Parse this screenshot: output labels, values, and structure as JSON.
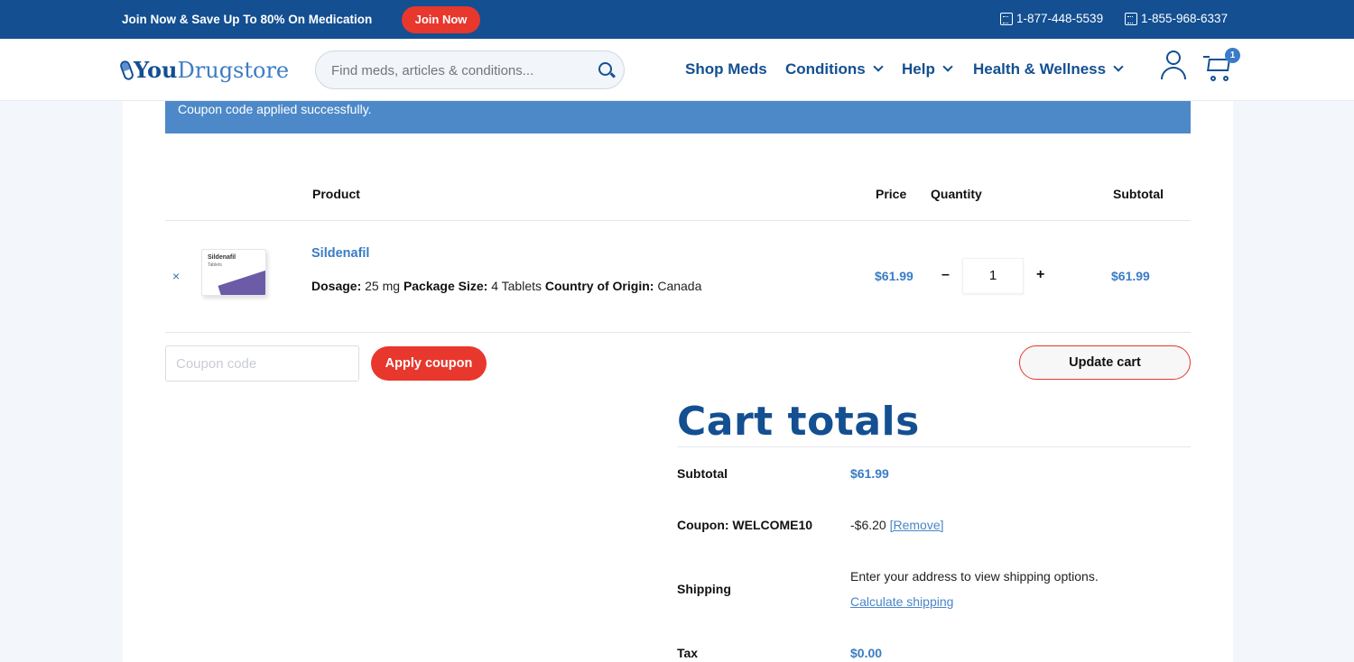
{
  "topbar": {
    "promo_text": "Join Now & Save Up To 80% On Medication",
    "join_label": "Join Now",
    "phone_1": "1-877-448-5539",
    "phone_2": "1-855-968-6337"
  },
  "header": {
    "logo_you": "You",
    "logo_drugstore": "Drugstore",
    "search_placeholder": "Find meds, articles & conditions...",
    "nav": {
      "shop_meds": "Shop Meds",
      "conditions": "Conditions",
      "help": "Help",
      "health_wellness": "Health & Wellness"
    },
    "cart_count": "1"
  },
  "notice": {
    "message": "Coupon code applied successfully."
  },
  "cart_table": {
    "headers": {
      "product": "Product",
      "price": "Price",
      "quantity": "Quantity",
      "subtotal": "Subtotal"
    },
    "items": [
      {
        "remove": "×",
        "image_title": "Sildenafil",
        "image_subtitle": "Tablets",
        "name": "Sildenafil",
        "dosage_label": "Dosage:",
        "dosage_value": "25 mg",
        "package_label": "Package Size:",
        "package_value": "4 Tablets",
        "origin_label": "Country of Origin:",
        "origin_value": "Canada",
        "price": "$61.99",
        "qty_minus": "–",
        "quantity": "1",
        "qty_plus": "+",
        "subtotal": "$61.99"
      }
    ]
  },
  "actions": {
    "coupon_placeholder": "Coupon code",
    "apply_label": "Apply coupon",
    "update_label": "Update cart"
  },
  "totals": {
    "title": "Cart totals",
    "subtotal_label": "Subtotal",
    "subtotal_value": "$61.99",
    "coupon_label": "Coupon: WELCOME10",
    "coupon_value": "-$6.20",
    "coupon_remove": "[Remove]",
    "shipping_label": "Shipping",
    "shipping_text": "Enter your address to view shipping options.",
    "shipping_link": "Calculate shipping",
    "tax_label": "Tax",
    "tax_value": "$0.00"
  },
  "colors": {
    "brand_blue": "#134f91",
    "accent_red": "#e8372c",
    "link_blue": "#3a7cc6",
    "notice_blue": "#4d89c9"
  }
}
